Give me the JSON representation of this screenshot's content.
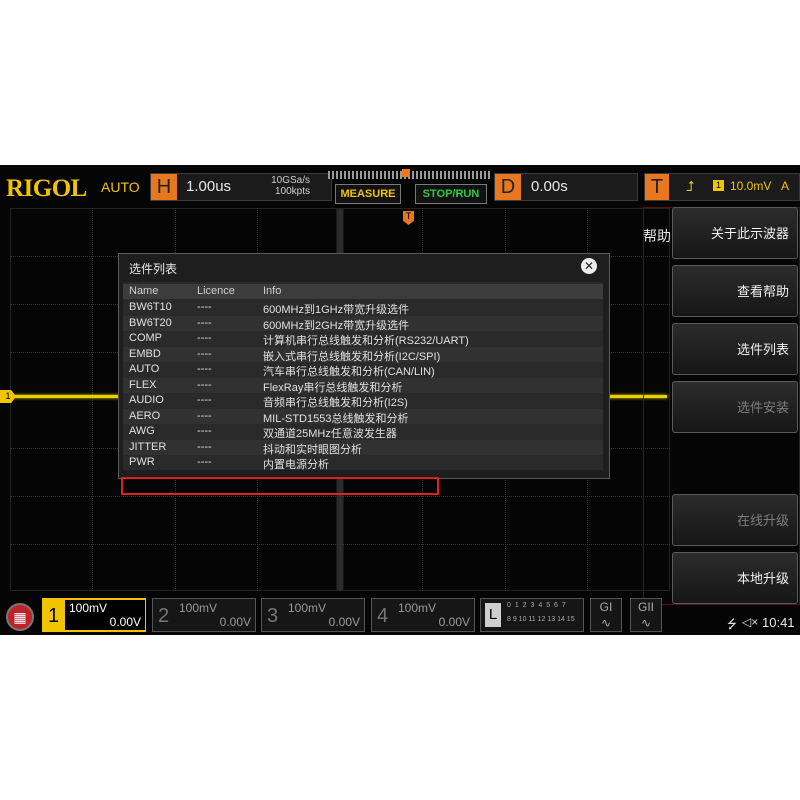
{
  "header": {
    "brand": "RIGOL",
    "mode": "AUTO",
    "horizontal": {
      "letter": "H",
      "timebase": "1.00us",
      "sample_rate": "10GSa/s",
      "memory": "100kpts"
    },
    "measure_label": "MEASURE",
    "stoprun_label": "STOP/RUN",
    "delay": {
      "letter": "D",
      "value": "0.00s"
    },
    "trigger": {
      "letter": "T",
      "edge_icon": "rising-edge-icon",
      "source": "1",
      "level": "10.0mV",
      "mode": "A"
    }
  },
  "markers": {
    "ch1": "1",
    "trigger": "T"
  },
  "dialog": {
    "title": "选件列表",
    "close_icon": "close-icon",
    "columns": [
      "Name",
      "Licence",
      "Info"
    ],
    "rows": [
      {
        "name": "BW6T10",
        "licence": "----",
        "info": "600MHz到1GHz带宽升级选件"
      },
      {
        "name": "BW6T20",
        "licence": "----",
        "info": "600MHz到2GHz带宽升级选件"
      },
      {
        "name": "COMP",
        "licence": "----",
        "info": "计算机串行总线触发和分析(RS232/UART)"
      },
      {
        "name": "EMBD",
        "licence": "----",
        "info": "嵌入式串行总线触发和分析(I2C/SPI)"
      },
      {
        "name": "AUTO",
        "licence": "----",
        "info": "汽车串行总线触发和分析(CAN/LIN)"
      },
      {
        "name": "FLEX",
        "licence": "----",
        "info": "FlexRay串行总线触发和分析"
      },
      {
        "name": "AUDIO",
        "licence": "----",
        "info": "音频串行总线触发和分析(I2S)"
      },
      {
        "name": "AERO",
        "licence": "----",
        "info": "MIL-STD1553总线触发和分析"
      },
      {
        "name": "AWG",
        "licence": "----",
        "info": "双通道25MHz任意波发生器"
      },
      {
        "name": "JITTER",
        "licence": "----",
        "info": "抖动和实时眼图分析"
      },
      {
        "name": "PWR",
        "licence": "----",
        "info": "内置电源分析"
      }
    ]
  },
  "side_menu": {
    "tab_label": "帮助",
    "buttons": [
      {
        "label": "关于此示波器",
        "enabled": true
      },
      {
        "label": "查看帮助",
        "enabled": true
      },
      {
        "label": "选件列表",
        "enabled": true
      },
      {
        "label": "选件安装",
        "enabled": false
      },
      {
        "label": "在线升级",
        "enabled": false
      },
      {
        "label": "本地升级",
        "enabled": true
      }
    ]
  },
  "channels": [
    {
      "num": "1",
      "scale": "100mV",
      "offset": "0.00V",
      "active": true
    },
    {
      "num": "2",
      "scale": "100mV",
      "offset": "0.00V",
      "active": false
    },
    {
      "num": "3",
      "scale": "100mV",
      "offset": "0.00V",
      "active": false
    },
    {
      "num": "4",
      "scale": "100mV",
      "offset": "0.00V",
      "active": false
    }
  ],
  "logic": {
    "letter": "L",
    "row1": "0 1 2 3  4 5 6 7",
    "row2": "8 9 10 11 12 13 14 15"
  },
  "generators": [
    "GI",
    "GII"
  ],
  "status": {
    "usb_icon": "usb-icon",
    "speaker_icon": "speaker-icon",
    "time": "10:41"
  },
  "colors": {
    "ch1": "#f1c400",
    "orange": "#e8781f",
    "highlight": "#e02020",
    "menu_button": "#c0222a"
  }
}
